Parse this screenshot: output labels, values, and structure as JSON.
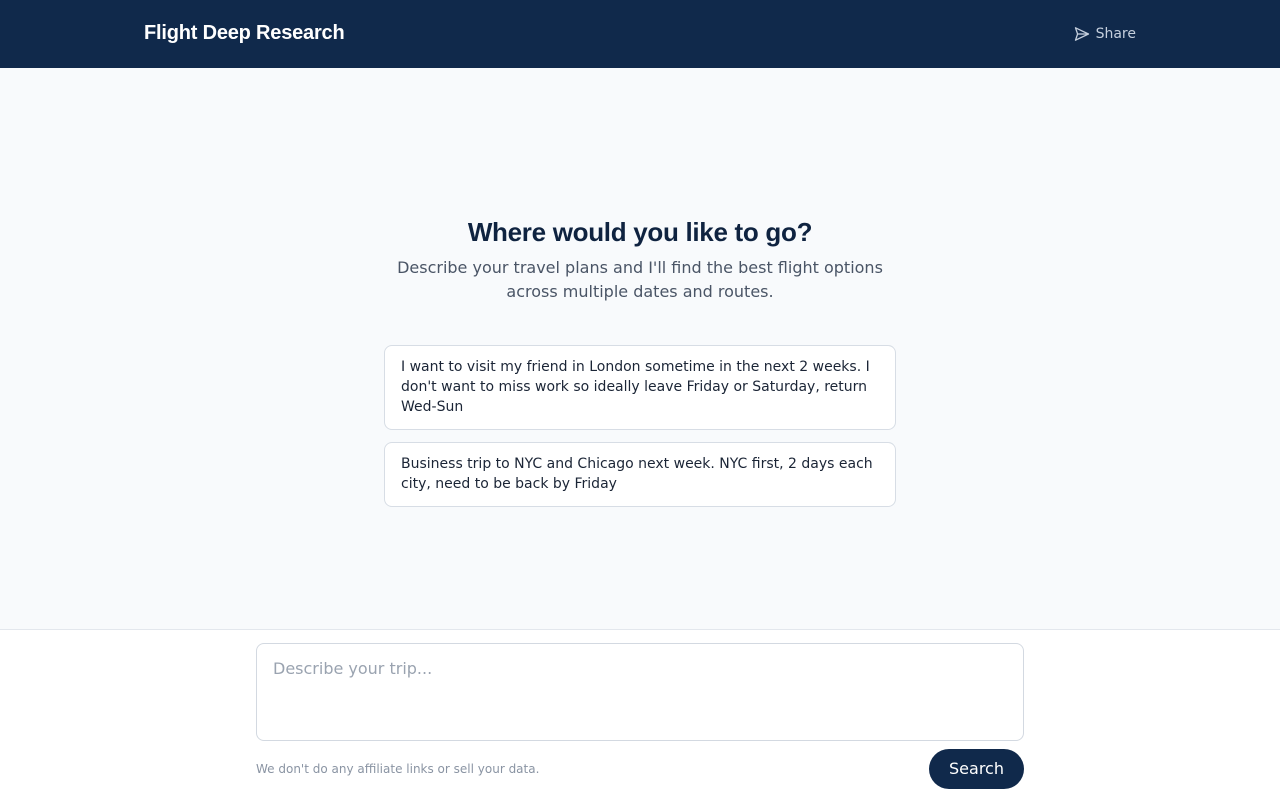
{
  "header": {
    "brand": "Flight Deep Research",
    "share_label": "Share",
    "share_icon": "send-icon"
  },
  "hero": {
    "title": "Where would you like to go?",
    "subtitle": "Describe your travel plans and I'll find the best flight options across multiple dates and routes."
  },
  "suggestions": [
    {
      "text": "I want to visit my friend in London sometime in the next 2 weeks. I don't want to miss work so ideally leave Friday or Saturday, return Wed-Sun"
    },
    {
      "text": "Business trip to NYC and Chicago next week. NYC first, 2 days each city, need to be back by Friday"
    }
  ],
  "composer": {
    "placeholder": "Describe your trip...",
    "value": "",
    "disclaimer": "We don't do any affiliate links or sell your data.",
    "search_label": "Search"
  },
  "colors": {
    "header_bg": "#10294b",
    "page_bg": "#f8fafc",
    "accent": "#10294b"
  }
}
